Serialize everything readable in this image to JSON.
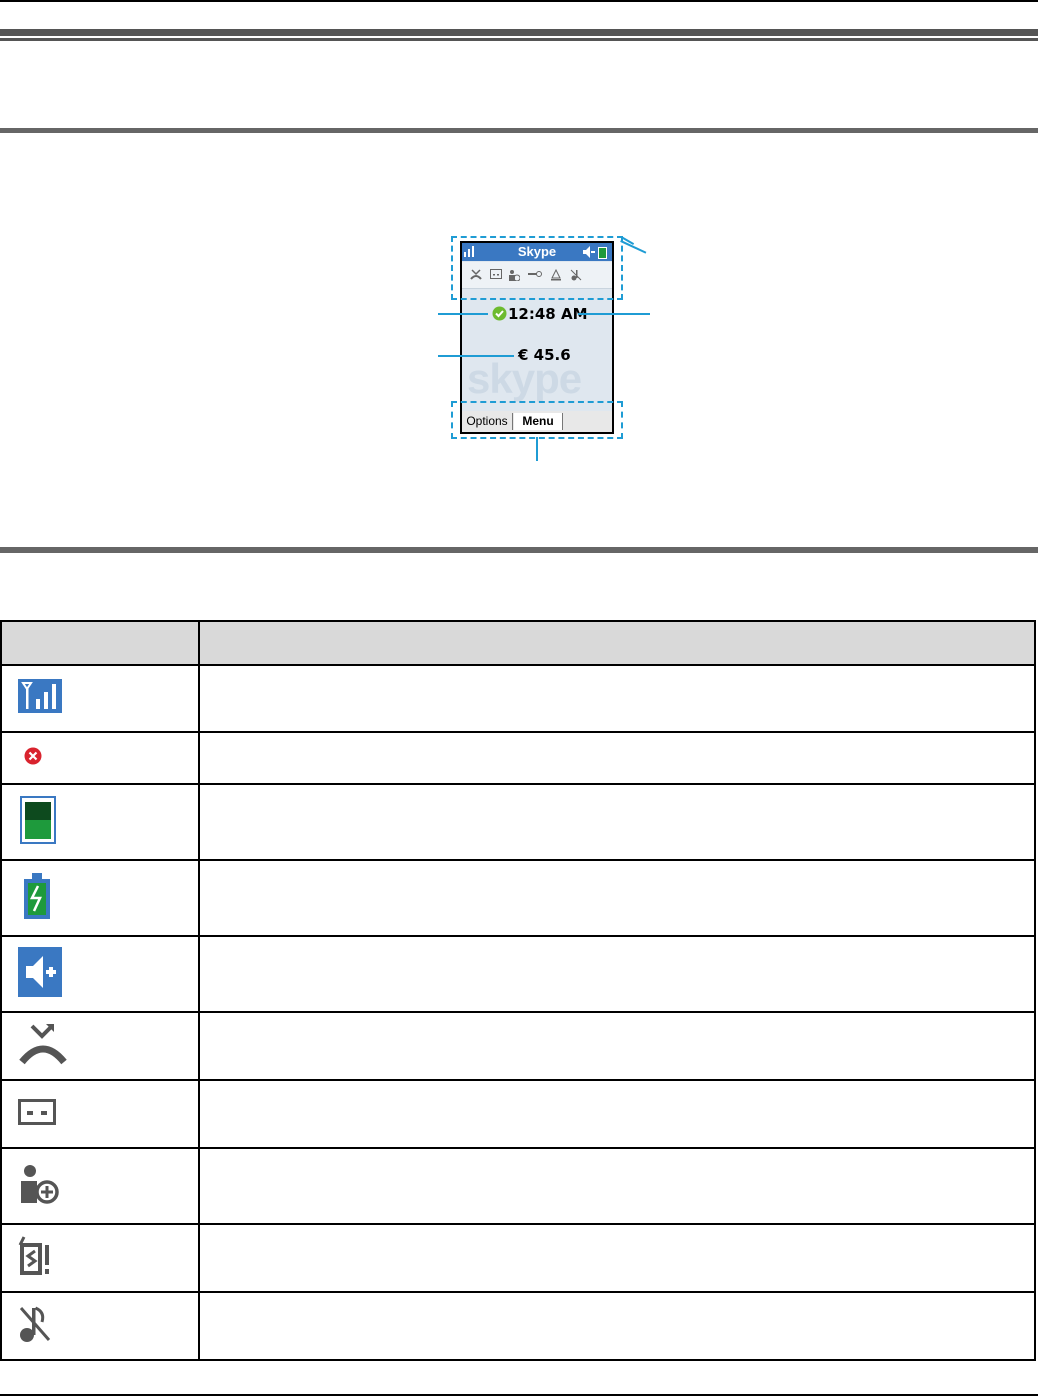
{
  "phone_screen": {
    "title": "Skype",
    "time": "12:48 AM",
    "credit": "€ 45.6",
    "watermark": "skype",
    "softkeys": [
      "Options",
      "Menu"
    ]
  },
  "table": {
    "headers": [
      "",
      ""
    ],
    "rows": [
      {
        "icon": "signal-strength-icon",
        "desc": ""
      },
      {
        "icon": "offline-status-icon",
        "desc": ""
      },
      {
        "icon": "battery-full-icon",
        "desc": ""
      },
      {
        "icon": "battery-charging-icon",
        "desc": ""
      },
      {
        "icon": "speakerphone-icon",
        "desc": ""
      },
      {
        "icon": "missed-call-icon",
        "desc": ""
      },
      {
        "icon": "voicemail-icon",
        "desc": ""
      },
      {
        "icon": "contact-request-icon",
        "desc": ""
      },
      {
        "icon": "alert-icon",
        "desc": ""
      },
      {
        "icon": "ringer-off-icon",
        "desc": ""
      }
    ]
  },
  "colors": {
    "accent": "#1f9cd4",
    "title_bar": "#3a78c2",
    "battery_green": "#1e9a3c",
    "offline_red": "#d9232e",
    "icon_gray": "#555555"
  }
}
